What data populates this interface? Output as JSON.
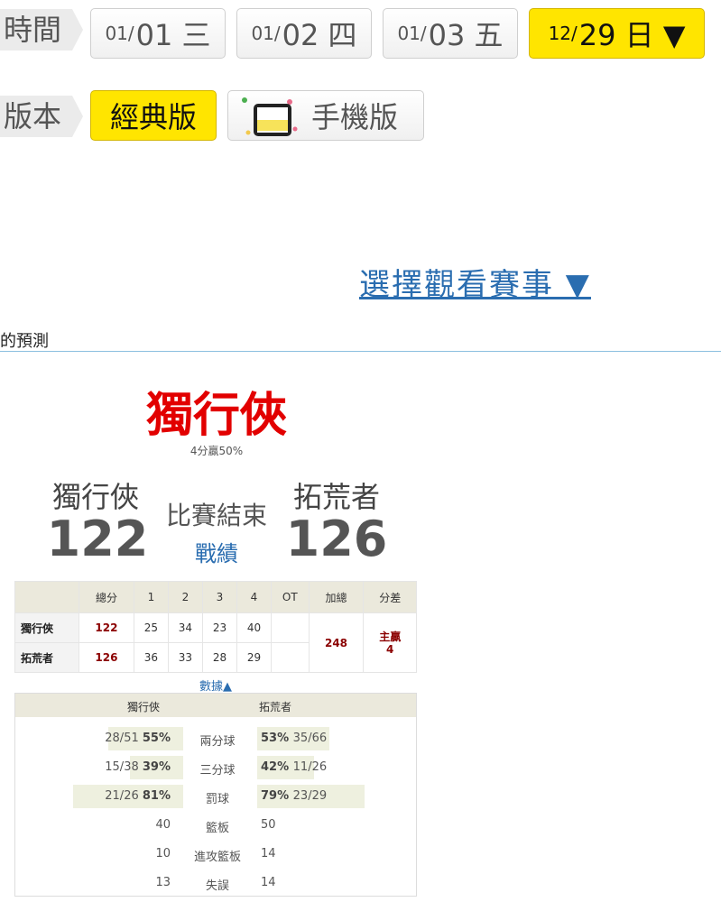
{
  "time_label": "時間",
  "dates": [
    {
      "month": "01/",
      "day": "01 三",
      "active": false
    },
    {
      "month": "01/",
      "day": "02 四",
      "active": false
    },
    {
      "month": "01/",
      "day": "03 五",
      "active": false
    },
    {
      "month": "12/",
      "day": "29 日 ▼",
      "active": true
    }
  ],
  "version_label": "版本",
  "versions": {
    "classic": "經典版",
    "mobile": "手機版"
  },
  "select_match": "選擇觀看賽事 ▼",
  "section_title": "我的預測",
  "winner": {
    "name": "獨行俠",
    "note": "4分贏50%"
  },
  "game": {
    "home": {
      "name": "獨行俠",
      "score": "122"
    },
    "away": {
      "name": "拓荒者",
      "score": "126"
    },
    "status": "比賽結束",
    "record_link": "戰績"
  },
  "box": {
    "headers": [
      "總分",
      "1",
      "2",
      "3",
      "4",
      "OT",
      "加總",
      "分差"
    ],
    "rows": [
      {
        "team": "獨行俠",
        "total": "122",
        "q": [
          "25",
          "34",
          "23",
          "40"
        ],
        "ot": ""
      },
      {
        "team": "拓荒者",
        "total": "126",
        "q": [
          "36",
          "33",
          "28",
          "29"
        ],
        "ot": ""
      }
    ],
    "sum": "248",
    "diff_label": "主贏",
    "diff_value": "4"
  },
  "data_toggle": "數據▲",
  "stats": {
    "home": "獨行俠",
    "away": "拓荒者",
    "rows": [
      {
        "label": "兩分球",
        "left_frac": "28/51",
        "left_pct": "55%",
        "right_pct": "53%",
        "right_frac": "35/66",
        "left_bar": 0.55,
        "right_bar": 0.53
      },
      {
        "label": "三分球",
        "left_frac": "15/38",
        "left_pct": "39%",
        "right_pct": "42%",
        "right_frac": "11/26",
        "left_bar": 0.39,
        "right_bar": 0.42
      },
      {
        "label": "罰球",
        "left_frac": "21/26",
        "left_pct": "81%",
        "right_pct": "79%",
        "right_frac": "23/29",
        "left_bar": 0.81,
        "right_bar": 0.79
      },
      {
        "label": "籃板",
        "left_frac": "",
        "left_pct": "40",
        "right_pct": "50",
        "right_frac": ""
      },
      {
        "label": "進攻籃板",
        "left_frac": "",
        "left_pct": "10",
        "right_pct": "14",
        "right_frac": ""
      },
      {
        "label": "失誤",
        "left_frac": "",
        "left_pct": "13",
        "right_pct": "14",
        "right_frac": ""
      }
    ]
  },
  "colors": {
    "accent_yellow": "#ffe500",
    "link_blue": "#2a6db0",
    "winner_red": "#e20000",
    "score_red": "#8b0000"
  }
}
